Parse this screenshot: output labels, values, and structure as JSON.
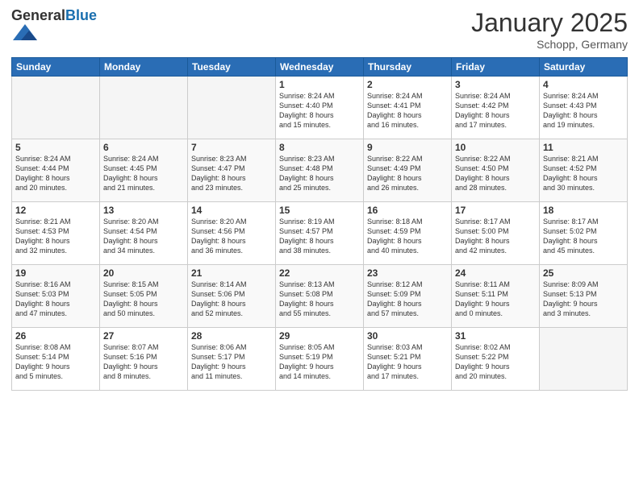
{
  "logo": {
    "general": "General",
    "blue": "Blue"
  },
  "header": {
    "month": "January 2025",
    "location": "Schopp, Germany"
  },
  "weekdays": [
    "Sunday",
    "Monday",
    "Tuesday",
    "Wednesday",
    "Thursday",
    "Friday",
    "Saturday"
  ],
  "weeks": [
    [
      {
        "day": "",
        "info": ""
      },
      {
        "day": "",
        "info": ""
      },
      {
        "day": "",
        "info": ""
      },
      {
        "day": "1",
        "info": "Sunrise: 8:24 AM\nSunset: 4:40 PM\nDaylight: 8 hours\nand 15 minutes."
      },
      {
        "day": "2",
        "info": "Sunrise: 8:24 AM\nSunset: 4:41 PM\nDaylight: 8 hours\nand 16 minutes."
      },
      {
        "day": "3",
        "info": "Sunrise: 8:24 AM\nSunset: 4:42 PM\nDaylight: 8 hours\nand 17 minutes."
      },
      {
        "day": "4",
        "info": "Sunrise: 8:24 AM\nSunset: 4:43 PM\nDaylight: 8 hours\nand 19 minutes."
      }
    ],
    [
      {
        "day": "5",
        "info": "Sunrise: 8:24 AM\nSunset: 4:44 PM\nDaylight: 8 hours\nand 20 minutes."
      },
      {
        "day": "6",
        "info": "Sunrise: 8:24 AM\nSunset: 4:45 PM\nDaylight: 8 hours\nand 21 minutes."
      },
      {
        "day": "7",
        "info": "Sunrise: 8:23 AM\nSunset: 4:47 PM\nDaylight: 8 hours\nand 23 minutes."
      },
      {
        "day": "8",
        "info": "Sunrise: 8:23 AM\nSunset: 4:48 PM\nDaylight: 8 hours\nand 25 minutes."
      },
      {
        "day": "9",
        "info": "Sunrise: 8:22 AM\nSunset: 4:49 PM\nDaylight: 8 hours\nand 26 minutes."
      },
      {
        "day": "10",
        "info": "Sunrise: 8:22 AM\nSunset: 4:50 PM\nDaylight: 8 hours\nand 28 minutes."
      },
      {
        "day": "11",
        "info": "Sunrise: 8:21 AM\nSunset: 4:52 PM\nDaylight: 8 hours\nand 30 minutes."
      }
    ],
    [
      {
        "day": "12",
        "info": "Sunrise: 8:21 AM\nSunset: 4:53 PM\nDaylight: 8 hours\nand 32 minutes."
      },
      {
        "day": "13",
        "info": "Sunrise: 8:20 AM\nSunset: 4:54 PM\nDaylight: 8 hours\nand 34 minutes."
      },
      {
        "day": "14",
        "info": "Sunrise: 8:20 AM\nSunset: 4:56 PM\nDaylight: 8 hours\nand 36 minutes."
      },
      {
        "day": "15",
        "info": "Sunrise: 8:19 AM\nSunset: 4:57 PM\nDaylight: 8 hours\nand 38 minutes."
      },
      {
        "day": "16",
        "info": "Sunrise: 8:18 AM\nSunset: 4:59 PM\nDaylight: 8 hours\nand 40 minutes."
      },
      {
        "day": "17",
        "info": "Sunrise: 8:17 AM\nSunset: 5:00 PM\nDaylight: 8 hours\nand 42 minutes."
      },
      {
        "day": "18",
        "info": "Sunrise: 8:17 AM\nSunset: 5:02 PM\nDaylight: 8 hours\nand 45 minutes."
      }
    ],
    [
      {
        "day": "19",
        "info": "Sunrise: 8:16 AM\nSunset: 5:03 PM\nDaylight: 8 hours\nand 47 minutes."
      },
      {
        "day": "20",
        "info": "Sunrise: 8:15 AM\nSunset: 5:05 PM\nDaylight: 8 hours\nand 50 minutes."
      },
      {
        "day": "21",
        "info": "Sunrise: 8:14 AM\nSunset: 5:06 PM\nDaylight: 8 hours\nand 52 minutes."
      },
      {
        "day": "22",
        "info": "Sunrise: 8:13 AM\nSunset: 5:08 PM\nDaylight: 8 hours\nand 55 minutes."
      },
      {
        "day": "23",
        "info": "Sunrise: 8:12 AM\nSunset: 5:09 PM\nDaylight: 8 hours\nand 57 minutes."
      },
      {
        "day": "24",
        "info": "Sunrise: 8:11 AM\nSunset: 5:11 PM\nDaylight: 9 hours\nand 0 minutes."
      },
      {
        "day": "25",
        "info": "Sunrise: 8:09 AM\nSunset: 5:13 PM\nDaylight: 9 hours\nand 3 minutes."
      }
    ],
    [
      {
        "day": "26",
        "info": "Sunrise: 8:08 AM\nSunset: 5:14 PM\nDaylight: 9 hours\nand 5 minutes."
      },
      {
        "day": "27",
        "info": "Sunrise: 8:07 AM\nSunset: 5:16 PM\nDaylight: 9 hours\nand 8 minutes."
      },
      {
        "day": "28",
        "info": "Sunrise: 8:06 AM\nSunset: 5:17 PM\nDaylight: 9 hours\nand 11 minutes."
      },
      {
        "day": "29",
        "info": "Sunrise: 8:05 AM\nSunset: 5:19 PM\nDaylight: 9 hours\nand 14 minutes."
      },
      {
        "day": "30",
        "info": "Sunrise: 8:03 AM\nSunset: 5:21 PM\nDaylight: 9 hours\nand 17 minutes."
      },
      {
        "day": "31",
        "info": "Sunrise: 8:02 AM\nSunset: 5:22 PM\nDaylight: 9 hours\nand 20 minutes."
      },
      {
        "day": "",
        "info": ""
      }
    ]
  ]
}
